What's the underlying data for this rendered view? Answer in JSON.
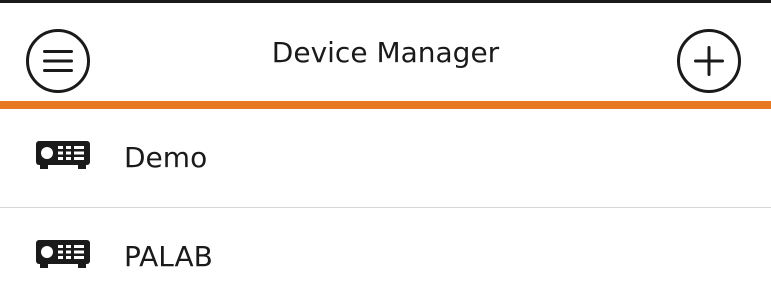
{
  "colors": {
    "accent": "#e87722",
    "text": "#1a1a1a",
    "divider": "#d6d6d6",
    "background": "#ffffff"
  },
  "header": {
    "title": "Device Manager",
    "menu_icon": "hamburger-menu-icon",
    "add_icon": "plus-icon"
  },
  "devices": [
    {
      "label": "Demo",
      "icon": "projector-icon"
    },
    {
      "label": "PALAB",
      "icon": "projector-icon"
    }
  ]
}
